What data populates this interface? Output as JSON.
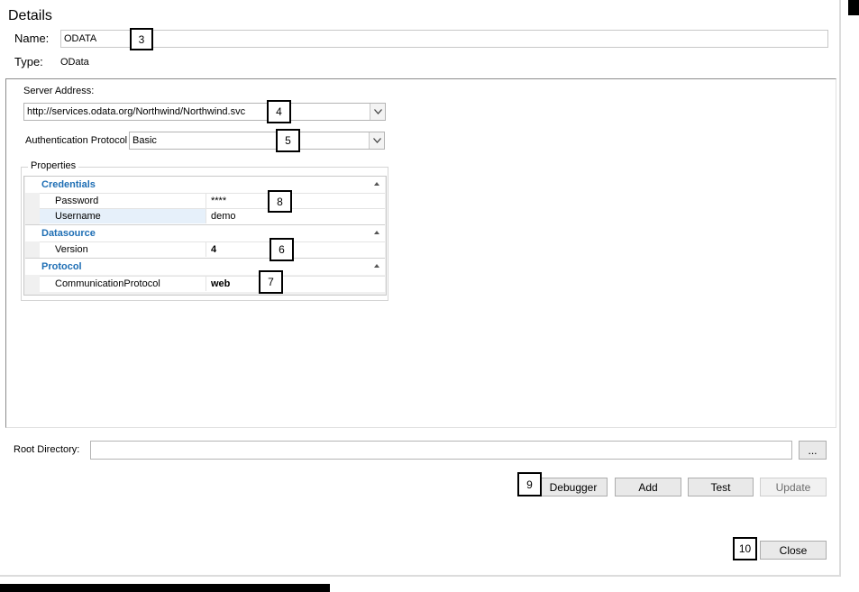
{
  "details": {
    "title": "Details",
    "name_label": "Name:",
    "name_value": "ODATA",
    "type_label": "Type:",
    "type_value": "OData"
  },
  "server": {
    "address_label": "Server Address:",
    "address_value": "http://services.odata.org/Northwind/Northwind.svc",
    "auth_label": "Authentication Protocol",
    "auth_value": "Basic"
  },
  "properties": {
    "group_label": "Properties",
    "categories": [
      {
        "label": "Credentials",
        "rows": [
          {
            "name": "Password",
            "value": "****"
          },
          {
            "name": "Username",
            "value": "demo"
          }
        ]
      },
      {
        "label": "Datasource",
        "rows": [
          {
            "name": "Version",
            "value": "4"
          }
        ]
      },
      {
        "label": "Protocol",
        "rows": [
          {
            "name": "CommunicationProtocol",
            "value": "web"
          }
        ]
      }
    ]
  },
  "root": {
    "label": "Root Directory:",
    "value": "",
    "browse_label": "..."
  },
  "buttons": {
    "debugger": "Debugger",
    "add": "Add",
    "test": "Test",
    "update": "Update",
    "close": "Close"
  },
  "callouts": {
    "c3": "3",
    "c4": "4",
    "c5": "5",
    "c6": "6",
    "c7": "7",
    "c8": "8",
    "c9": "9",
    "c10": "10"
  },
  "icons": {
    "combo": "chevron-down-icon",
    "collapse": "collapse-triangle-icon"
  }
}
